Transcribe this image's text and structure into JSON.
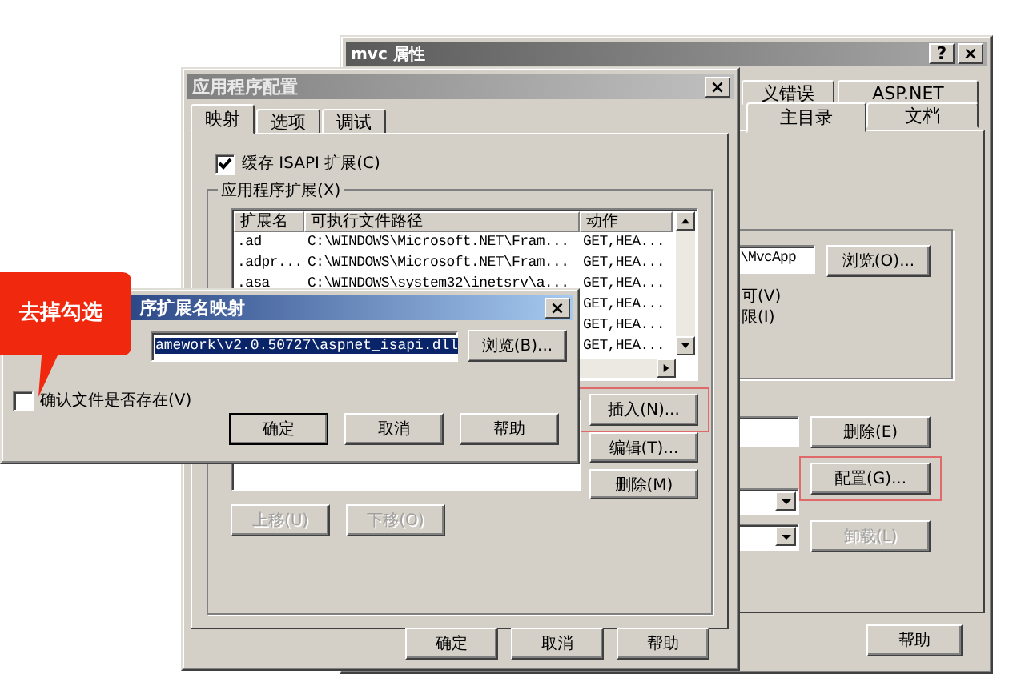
{
  "properties_window": {
    "title": "mvc 属性",
    "help_button": "?",
    "close_button": "×",
    "tabs": [
      {
        "label": "义错误",
        "selected": false
      },
      {
        "label": "ASP.NET",
        "selected": false
      },
      {
        "label": "主目录",
        "selected": true
      },
      {
        "label": "文档",
        "selected": false
      }
    ],
    "path_field": {
      "value": "\\MvcApp"
    },
    "browse_button": "浏览(O)...",
    "option_labels": [
      "可(V)",
      "限(I)"
    ],
    "buttons": [
      {
        "label": "删除(E)",
        "highlighted": false,
        "disabled": false
      },
      {
        "label": "配置(G)...",
        "highlighted": true,
        "disabled": false
      },
      {
        "label": "卸载(L)",
        "highlighted": false,
        "disabled": true
      }
    ],
    "footer_buttons": [
      "帮助"
    ]
  },
  "config_dialog": {
    "title": "应用程序配置",
    "close_button": "×",
    "tabs": [
      {
        "label": "映射",
        "selected": true
      },
      {
        "label": "选项",
        "selected": false
      },
      {
        "label": "调试",
        "selected": false
      }
    ],
    "cache_checkbox": {
      "label": "缓存 ISAPI 扩展(C)",
      "checked": true
    },
    "extensions_group": {
      "title": "应用程序扩展(X)",
      "columns": [
        "扩展名",
        "可执行文件路径",
        "动作"
      ],
      "rows": [
        {
          "ext": ".ad",
          "path": "C:\\WINDOWS\\Microsoft.NET\\Fram...",
          "action": "GET,HEA..."
        },
        {
          "ext": ".adpr...",
          "path": "C:\\WINDOWS\\Microsoft.NET\\Fram...",
          "action": "GET,HEA..."
        },
        {
          "ext": ".asa",
          "path": "C:\\WINDOWS\\system32\\inetsrv\\a...",
          "action": "GET,HEA..."
        },
        {
          "action": "GET,HEA..."
        },
        {
          "action": "GET,HEA..."
        },
        {
          "action": "GET,HEA..."
        }
      ]
    },
    "side_buttons": [
      {
        "label": "插入(N)...",
        "highlighted": true
      },
      {
        "label": "编辑(T)...",
        "highlighted": false
      },
      {
        "label": "删除(M)",
        "highlighted": false
      }
    ],
    "move_buttons": [
      {
        "label": "上移(U)",
        "disabled": true
      },
      {
        "label": "下移(O)",
        "disabled": true
      }
    ],
    "footer_buttons": [
      "确定",
      "取消",
      "帮助"
    ]
  },
  "mapping_dialog": {
    "title": "序扩展名映射",
    "close_button": "×",
    "executable_field": {
      "value": "amework\\v2.0.50727\\aspnet_isapi.dll",
      "text_selected": true
    },
    "browse_button": "浏览(B)...",
    "verify_checkbox": {
      "label": "确认文件是否存在(V)",
      "checked": false
    },
    "buttons": [
      {
        "label": "确定",
        "default": true
      },
      {
        "label": "取消",
        "default": false
      },
      {
        "label": "帮助",
        "default": false
      }
    ]
  },
  "callout": {
    "text": "去掉勾选"
  }
}
